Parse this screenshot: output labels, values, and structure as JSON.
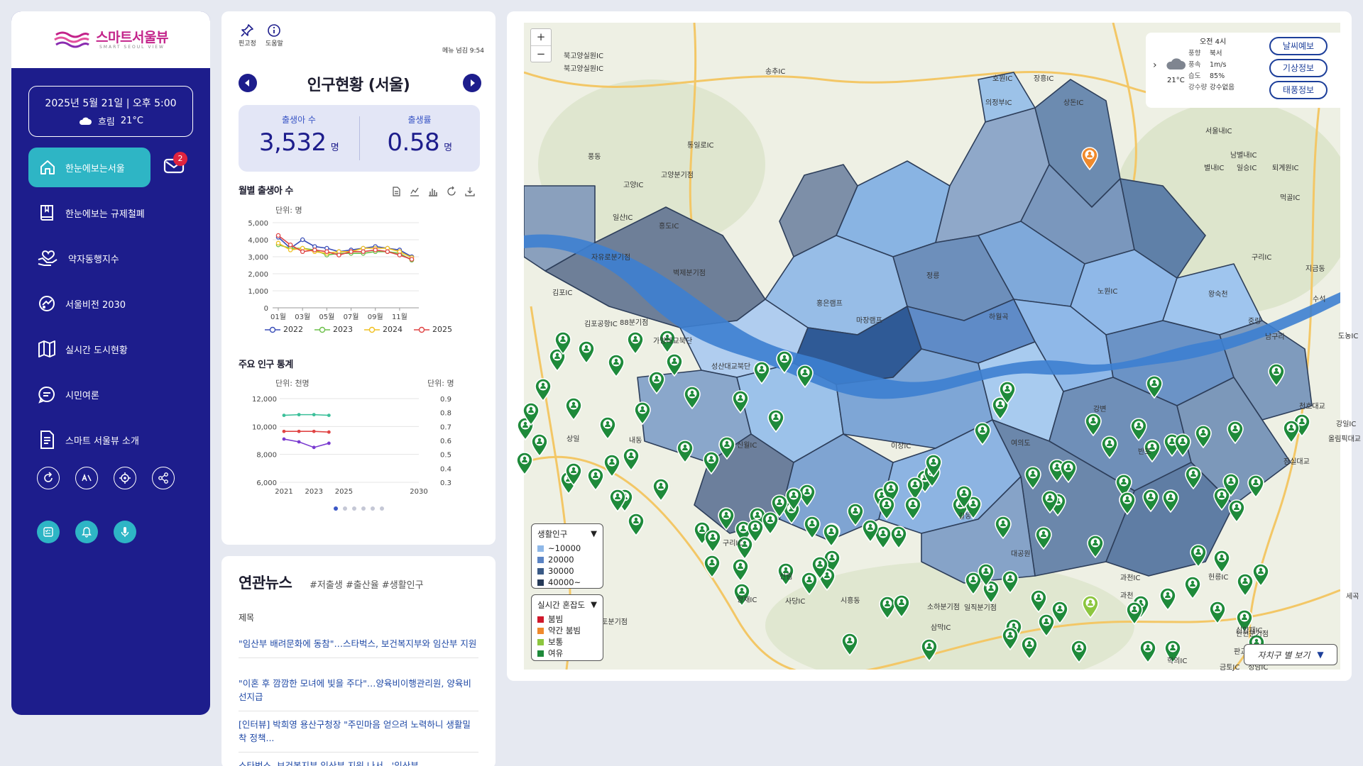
{
  "app": {
    "logo_text": "스마트서울뷰",
    "logo_sub": "SMART SEOUL VIEW"
  },
  "datebox": {
    "datetime": "2025년 5월 21일 | 오후 5:00",
    "weather": "흐림",
    "temp": "21°C"
  },
  "sidebar": {
    "home_label": "한눈에보는서울",
    "mail_badge": "2",
    "items": [
      {
        "label": "한눈에보는 규제철폐",
        "icon": "book-icon"
      },
      {
        "label": "약자동행지수",
        "icon": "hands-heart-icon"
      },
      {
        "label": "서울비전 2030",
        "icon": "vision-icon"
      },
      {
        "label": "실시간 도시현황",
        "icon": "map-icon"
      },
      {
        "label": "시민여론",
        "icon": "chat-icon"
      },
      {
        "label": "스마트 서울뷰 소개",
        "icon": "document-icon"
      }
    ]
  },
  "panel": {
    "pin_label": "핀고정",
    "help_label": "도움말",
    "menu_time": "메뉴 넘김 9:54",
    "title": "인구현황 (서울)",
    "stats": [
      {
        "label": "출생아 수",
        "value": "3,532",
        "unit": "명"
      },
      {
        "label": "출생률",
        "value": "0.58",
        "unit": "명"
      }
    ],
    "monthly_title": "월별 출생아 수",
    "monthly_unit": "단위: 명",
    "major_title": "주요 인구 통계",
    "major_unit_left": "단위: 천명",
    "major_unit_right": "단위: 명"
  },
  "chart_data": [
    {
      "type": "line",
      "title": "월별 출생아 수",
      "ylabel": "단위: 명",
      "x": [
        "01월",
        "02월",
        "03월",
        "04월",
        "05월",
        "06월",
        "07월",
        "08월",
        "09월",
        "10월",
        "11월",
        "12월"
      ],
      "x_tick_labels": [
        "01월",
        "03월",
        "05월",
        "07월",
        "09월",
        "11월"
      ],
      "ylim": [
        0,
        5000
      ],
      "y_ticks": [
        "0",
        "1,000",
        "2,000",
        "3,000",
        "4,000",
        "5,000"
      ],
      "legend": "bottom",
      "series": [
        {
          "name": "2022",
          "color": "#3b4fb8",
          "values": [
            4150,
            3500,
            4000,
            3600,
            3500,
            3300,
            3400,
            3500,
            3600,
            3500,
            3400,
            3000
          ]
        },
        {
          "name": "2023",
          "color": "#6cc04a",
          "values": [
            3700,
            3500,
            3500,
            3400,
            3100,
            3200,
            3200,
            3200,
            3300,
            3300,
            3200,
            2800
          ]
        },
        {
          "name": "2024",
          "color": "#f0c020",
          "values": [
            3800,
            3400,
            3500,
            3300,
            3200,
            3300,
            3300,
            3500,
            3500,
            3500,
            3300,
            2950
          ]
        },
        {
          "name": "2025",
          "color": "#e04444",
          "values": [
            4250,
            3700,
            3300,
            3400,
            3300,
            3100,
            3300,
            3300,
            3400,
            3300,
            3100,
            2850
          ]
        }
      ]
    },
    {
      "type": "line",
      "title": "주요 인구 통계",
      "ylabel": "단위: 천명",
      "y2label": "단위: 명",
      "xlim": [
        2021,
        2030
      ],
      "x_ticks": [
        "2021",
        "2023",
        "2025",
        "2030"
      ],
      "ylim": [
        6000,
        12000
      ],
      "y_ticks": [
        "6,000",
        "8,000",
        "10,000",
        "12,000"
      ],
      "y2lim": [
        0.3,
        0.9
      ],
      "y2_ticks": [
        "0.3",
        "0.4",
        "0.5",
        "0.6",
        "0.7",
        "0.8",
        "0.9"
      ],
      "series": [
        {
          "color": "#3cc09a",
          "axis": "left",
          "x": [
            2021,
            2022,
            2023,
            2024
          ],
          "values": [
            10800,
            10850,
            10850,
            10800
          ]
        },
        {
          "color": "#e04444",
          "axis": "left",
          "x": [
            2021,
            2022,
            2023,
            2024
          ],
          "values": [
            9650,
            9650,
            9650,
            9600
          ]
        },
        {
          "color": "#7a3bd0",
          "axis": "left",
          "x": [
            2021,
            2022,
            2023,
            2024
          ],
          "values": [
            9100,
            8900,
            8500,
            8800
          ]
        }
      ]
    }
  ],
  "news": {
    "title": "연관뉴스",
    "tags": "#저출생 #출산율 #생활인구",
    "header": "제목",
    "items": [
      "\"임산부 배려문화에 동참\"…스타벅스, 보건복지부와 임산부 지원",
      "\"이혼 후 깜깜한 모녀에 빛을 주다\"…양육비이행관리원, 양육비선지급",
      "[인터뷰] 박희영 용산구청장 \"주민마음 얻으려 노력하니 생활밀착 정책...",
      "스타벅스, 보건복지부 임산부 지원 나서...'임산부"
    ]
  },
  "map": {
    "zoom_in": "+",
    "zoom_out": "−",
    "weather": {
      "time": "오전 4시",
      "temp": "21°C",
      "rows": [
        {
          "k": "풍향",
          "v": "북서"
        },
        {
          "k": "풍속",
          "v": "1m/s"
        },
        {
          "k": "습도",
          "v": "85%"
        },
        {
          "k": "강수량",
          "v": "강수없음"
        }
      ],
      "buttons": [
        "날씨예보",
        "기상정보",
        "태풍정보"
      ]
    },
    "legend_pop": {
      "title": "생활인구",
      "items": [
        {
          "label": "~10000",
          "color": "#8fb8e8"
        },
        {
          "label": "20000",
          "color": "#5b84c4"
        },
        {
          "label": "30000",
          "color": "#3a5a86"
        },
        {
          "label": "40000~",
          "color": "#263a58"
        }
      ]
    },
    "legend_crowd": {
      "title": "실시간 혼잡도",
      "items": [
        {
          "label": "붐빔",
          "color": "#d0182b"
        },
        {
          "label": "약간 붐빔",
          "color": "#f08a2c"
        },
        {
          "label": "보통",
          "color": "#8cc63f"
        },
        {
          "label": "여유",
          "color": "#1e8a3a"
        }
      ]
    },
    "gu_button": "자치구 별 보기",
    "labels": [
      "북고양실원IC",
      "북고양실원IC",
      "송추IC",
      "호원IC",
      "장흥IC",
      "상돈IC",
      "의정부IC",
      "서울내IC",
      "남별내IC",
      "별내IC",
      "일승IC",
      "퇴계원IC",
      "먹골IC",
      "고양IC",
      "풍동",
      "통일로IC",
      "고양분기점",
      "일산IC",
      "흥도IC",
      "자유로분기점",
      "김포IC",
      "벽제분기점",
      "정릉",
      "하월곡",
      "노원IC",
      "구리IC",
      "중랑",
      "남구리",
      "도농IC",
      "지금동",
      "수석",
      "김포공항IC",
      "88분기점",
      "가양대교북단",
      "성산대교북단",
      "홍은램프",
      "마장램프",
      "왕숙천",
      "강변",
      "천호대교",
      "강일IC",
      "상일",
      "내동",
      "신월IC",
      "이상IC",
      "여의도",
      "반포",
      "잠실대교",
      "올림픽대교",
      "구리IC",
      "길동",
      "신림",
      "양재IC",
      "사당IC",
      "시흥동",
      "소하분기점",
      "일직분기점",
      "삼막IC",
      "과천IC",
      "과천",
      "대공원",
      "헌릉IC",
      "세곡",
      "신양재IC",
      "안현분기점",
      "금토분기점",
      "판교분기점",
      "금토JC",
      "성남IC",
      "학의IC"
    ]
  }
}
